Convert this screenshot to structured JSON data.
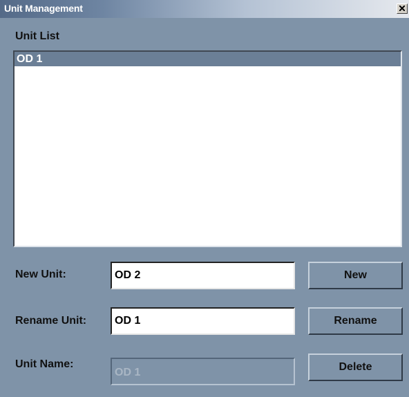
{
  "window": {
    "title": "Unit Management",
    "close_symbol": "×"
  },
  "unit_list": {
    "label": "Unit List",
    "items": [
      "OD 1"
    ],
    "selected_index": 0
  },
  "new_unit": {
    "label": "New Unit:",
    "value": "OD 2",
    "button_label": "New"
  },
  "rename_unit": {
    "label": "Rename Unit:",
    "value": "OD 1",
    "button_label": "Rename"
  },
  "unit_name": {
    "label": "Unit Name:",
    "value": "OD 1",
    "button_label": "Delete"
  },
  "colors": {
    "window_background": "#7f93a8",
    "list_selection": "#6b7f96",
    "title_text": "#ffffff"
  },
  "icons": {
    "close": "close-icon"
  }
}
